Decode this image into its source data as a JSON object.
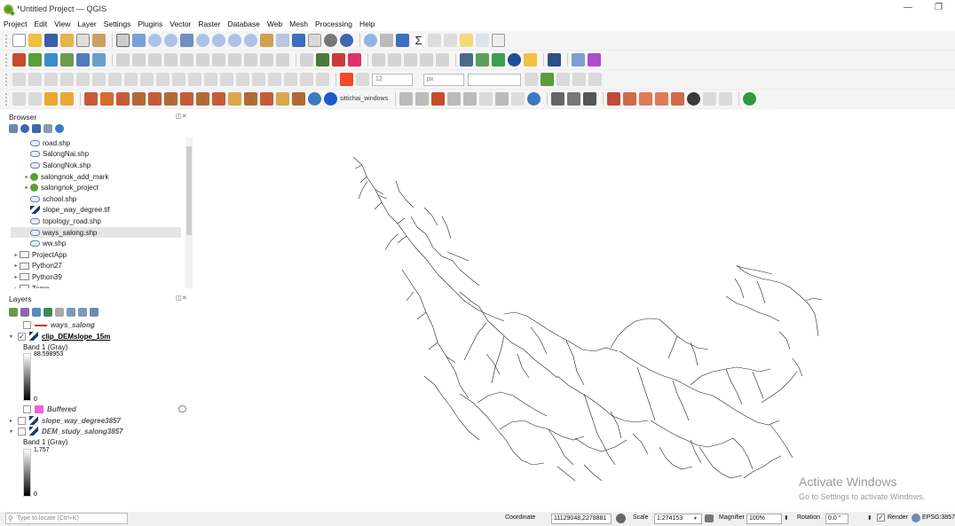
{
  "window": {
    "title": "*Untitled Project — QGIS",
    "minimize": "—",
    "maximize": "❐"
  },
  "menu": [
    "Project",
    "Edit",
    "View",
    "Layer",
    "Settings",
    "Plugins",
    "Vector",
    "Raster",
    "Database",
    "Web",
    "Mesh",
    "Processing",
    "Help"
  ],
  "toolbar": {
    "font_size_value": "12",
    "unit_value": "px",
    "username_label": "sittichai_windows"
  },
  "browser": {
    "title": "Browser",
    "panel_controls": "◫✕",
    "items": [
      {
        "label": "road.shp",
        "type": "shp",
        "indent": 2,
        "caret": ""
      },
      {
        "label": "SalongNai.shp",
        "type": "shp",
        "indent": 2,
        "caret": ""
      },
      {
        "label": "SalongNok.shp",
        "type": "shp",
        "indent": 2,
        "caret": ""
      },
      {
        "label": "salongnok_add_mark",
        "type": "qgz",
        "indent": 2,
        "caret": "▸"
      },
      {
        "label": "salongnok_project",
        "type": "qgz",
        "indent": 2,
        "caret": "▸"
      },
      {
        "label": "school.shp",
        "type": "shp",
        "indent": 2,
        "caret": ""
      },
      {
        "label": "slope_way_degree.tif",
        "type": "tif",
        "indent": 2,
        "caret": ""
      },
      {
        "label": "topology_road.shp",
        "type": "shp",
        "indent": 2,
        "caret": ""
      },
      {
        "label": "ways_salong.shp",
        "type": "shp",
        "indent": 2,
        "caret": "",
        "selected": true
      },
      {
        "label": "ww.shp",
        "type": "shp",
        "indent": 2,
        "caret": ""
      },
      {
        "label": "ProjectApp",
        "type": "folder",
        "indent": 1,
        "caret": "▸"
      },
      {
        "label": "Python27",
        "type": "folder",
        "indent": 1,
        "caret": "▸"
      },
      {
        "label": "Python39",
        "type": "folder",
        "indent": 1,
        "caret": "▸"
      },
      {
        "label": "Temp",
        "type": "folder",
        "indent": 1,
        "caret": "▸"
      }
    ]
  },
  "layers": {
    "title": "Layers",
    "panel_controls": "◫✕",
    "items": {
      "ways_salong": {
        "name": "ways_salong",
        "checked": false,
        "color": "#e0292e"
      },
      "clip_dem": {
        "name": "clip_DEMslope_15m",
        "checked": true,
        "band": "Band 1 (Gray)",
        "max": "88.598953",
        "min": "0"
      },
      "buffered": {
        "name": "Buffered",
        "checked": false,
        "color": "#f05fd6"
      },
      "slope_way": {
        "name": "slope_way_degree3857",
        "checked": false
      },
      "dem_study": {
        "name": "DEM_study_salong3857",
        "checked": false,
        "band": "Band 1 (Gray)",
        "max": "1,757",
        "min": "0"
      }
    }
  },
  "watermark": {
    "line1": "Activate Windows",
    "line2": "Go to Settings to activate Windows."
  },
  "status": {
    "locate_placeholder": "Type to locate (Ctrl+K)",
    "coordinate_label": "Coordinate",
    "coordinate_value": "11129048,2278881",
    "scale_label": "Scale",
    "scale_value": "1:274153",
    "magnifier_label": "Magnifier",
    "magnifier_value": "100%",
    "rotation_label": "Rotation",
    "rotation_value": "0.0 °",
    "render_label": "Render",
    "crs_label": "EPSG:3857"
  }
}
